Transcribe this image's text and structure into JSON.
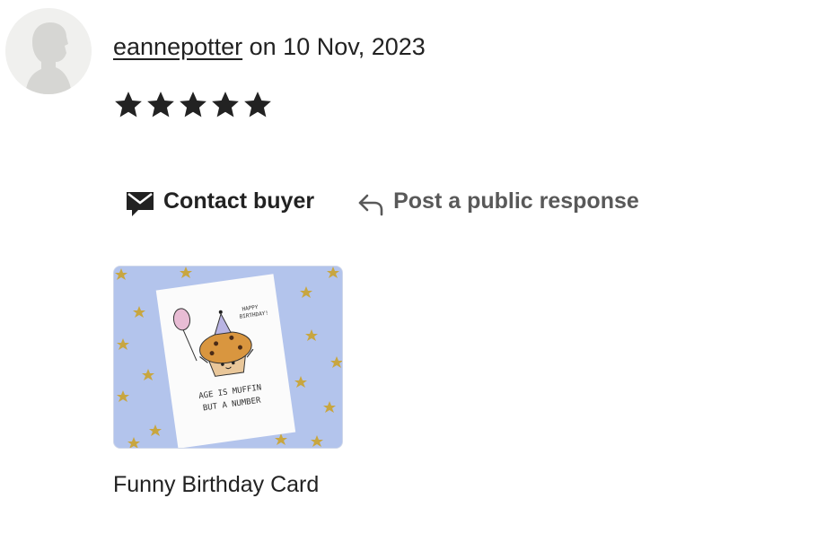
{
  "review": {
    "username": "eannepotter",
    "date_text": "on 10 Nov, 2023",
    "rating": 5,
    "rating_max": 5
  },
  "actions": {
    "contact_label": "Contact buyer",
    "respond_label": "Post a public response"
  },
  "product": {
    "title": "Funny Birthday Card",
    "card_text": {
      "greeting_line1": "HAPPY",
      "greeting_line2": "BIRTHDAY!",
      "line1": "AGE IS MUFFIN",
      "line2": "BUT A NUMBER"
    }
  },
  "icons": {
    "avatar": "default-user-avatar",
    "star": "star-icon",
    "contact": "envelope-icon",
    "respond": "reply-arrow-icon"
  },
  "colors": {
    "text": "#222222",
    "muted": "#595959",
    "thumb_bg": "#b3c4ec",
    "star": "#222222"
  }
}
